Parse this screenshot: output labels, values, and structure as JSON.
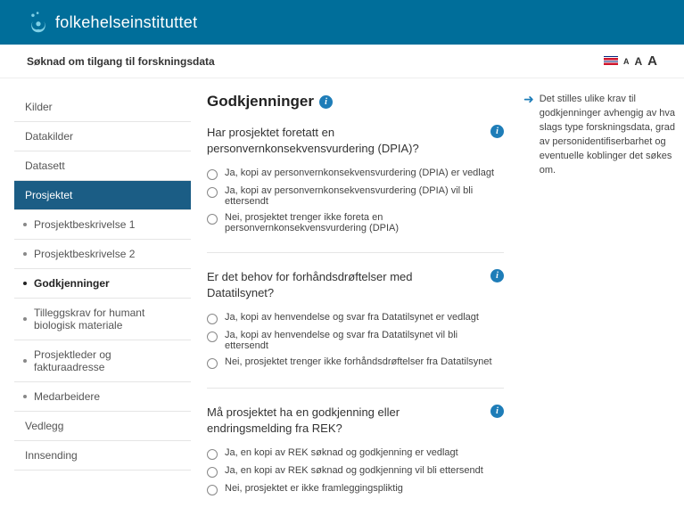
{
  "brand": "folkehelseinstituttet",
  "subtitle": "Søknad om tilgang til forskningsdata",
  "font_sizes": {
    "s": "A",
    "m": "A",
    "l": "A"
  },
  "sidebar": {
    "items": [
      {
        "label": "Kilder",
        "type": "top"
      },
      {
        "label": "Datakilder",
        "type": "top"
      },
      {
        "label": "Datasett",
        "type": "top"
      },
      {
        "label": "Prosjektet",
        "type": "top",
        "active": true
      },
      {
        "label": "Prosjektbeskrivelse 1",
        "type": "sub"
      },
      {
        "label": "Prosjektbeskrivelse 2",
        "type": "sub"
      },
      {
        "label": "Godkjenninger",
        "type": "sub",
        "current": true
      },
      {
        "label": "Tilleggskrav for humant biologisk materiale",
        "type": "sub"
      },
      {
        "label": "Prosjektleder og fakturaadresse",
        "type": "sub"
      },
      {
        "label": "Medarbeidere",
        "type": "sub"
      },
      {
        "label": "Vedlegg",
        "type": "top"
      },
      {
        "label": "Innsending",
        "type": "top"
      }
    ]
  },
  "page_title": "Godkjenninger",
  "questions": [
    {
      "text": "Har prosjektet foretatt en personvernkonsekvensvurdering (DPIA)?",
      "options": [
        "Ja, kopi av personvernkonsekvensvurdering (DPIA) er vedlagt",
        "Ja, kopi av personvernkonsekvensvurdering (DPIA) vil bli ettersendt",
        "Nei, prosjektet trenger ikke foreta en personvernkonsekvensvurdering (DPIA)"
      ]
    },
    {
      "text": "Er det behov for forhåndsdrøftelser med Datatilsynet?",
      "options": [
        "Ja, kopi av henvendelse og svar fra Datatilsynet er vedlagt",
        "Ja, kopi av henvendelse og svar fra Datatilsynet vil bli ettersendt",
        "Nei, prosjektet trenger ikke forhåndsdrøftelser fra Datatilsynet"
      ]
    },
    {
      "text": "Må prosjektet ha en godkjenning eller endringsmelding fra REK?",
      "options": [
        "Ja, en kopi av REK søknad og godkjenning er vedlagt",
        "Ja, en kopi av REK søknad og godkjenning vil bli ettersendt",
        "Nei, prosjektet er ikke framleggingspliktig"
      ]
    }
  ],
  "help_text": "Det stilles ulike krav til godkjenninger avhengig av hva slags type forskningsdata, grad av personidentifiserbarhet og eventuelle koblinger det søkes om."
}
